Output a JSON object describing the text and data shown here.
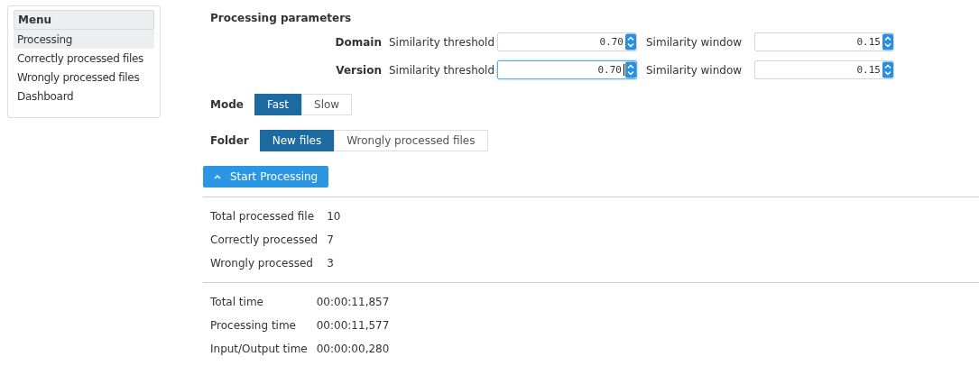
{
  "menu": {
    "title": "Menu",
    "items": [
      {
        "label": "Processing",
        "selected": true
      },
      {
        "label": "Correctly processed files",
        "selected": false
      },
      {
        "label": "Wrongly processed files",
        "selected": false
      },
      {
        "label": "Dashboard",
        "selected": false
      }
    ]
  },
  "parameters": {
    "title": "Processing parameters",
    "rows": [
      {
        "label": "Domain",
        "fields": [
          {
            "label": "Similarity threshold",
            "value": "0.70",
            "focused": false
          },
          {
            "label": "Similarity window",
            "value": "0.15",
            "focused": false
          }
        ]
      },
      {
        "label": "Version",
        "fields": [
          {
            "label": "Similarity threshold",
            "value": "0.70",
            "focused": true
          },
          {
            "label": "Similarity window",
            "value": "0.15",
            "focused": false
          }
        ]
      }
    ]
  },
  "mode": {
    "label": "Mode",
    "options": [
      {
        "label": "Fast",
        "selected": true
      },
      {
        "label": "Slow",
        "selected": false
      }
    ]
  },
  "folder": {
    "label": "Folder",
    "options": [
      {
        "label": "New files",
        "selected": true
      },
      {
        "label": "Wrongly processed files",
        "selected": false
      }
    ]
  },
  "start_button": {
    "label": "Start Processing"
  },
  "counts": [
    {
      "label": "Total processed file",
      "value": "10"
    },
    {
      "label": "Correctly processed",
      "value": "7"
    },
    {
      "label": "Wrongly processed",
      "value": "3"
    }
  ],
  "times": [
    {
      "label": "Total time",
      "value": "00:00:11,857"
    },
    {
      "label": "Processing time",
      "value": "00:00:11,577"
    },
    {
      "label": "Input/Output time",
      "value": "00:00:00,280"
    }
  ]
}
